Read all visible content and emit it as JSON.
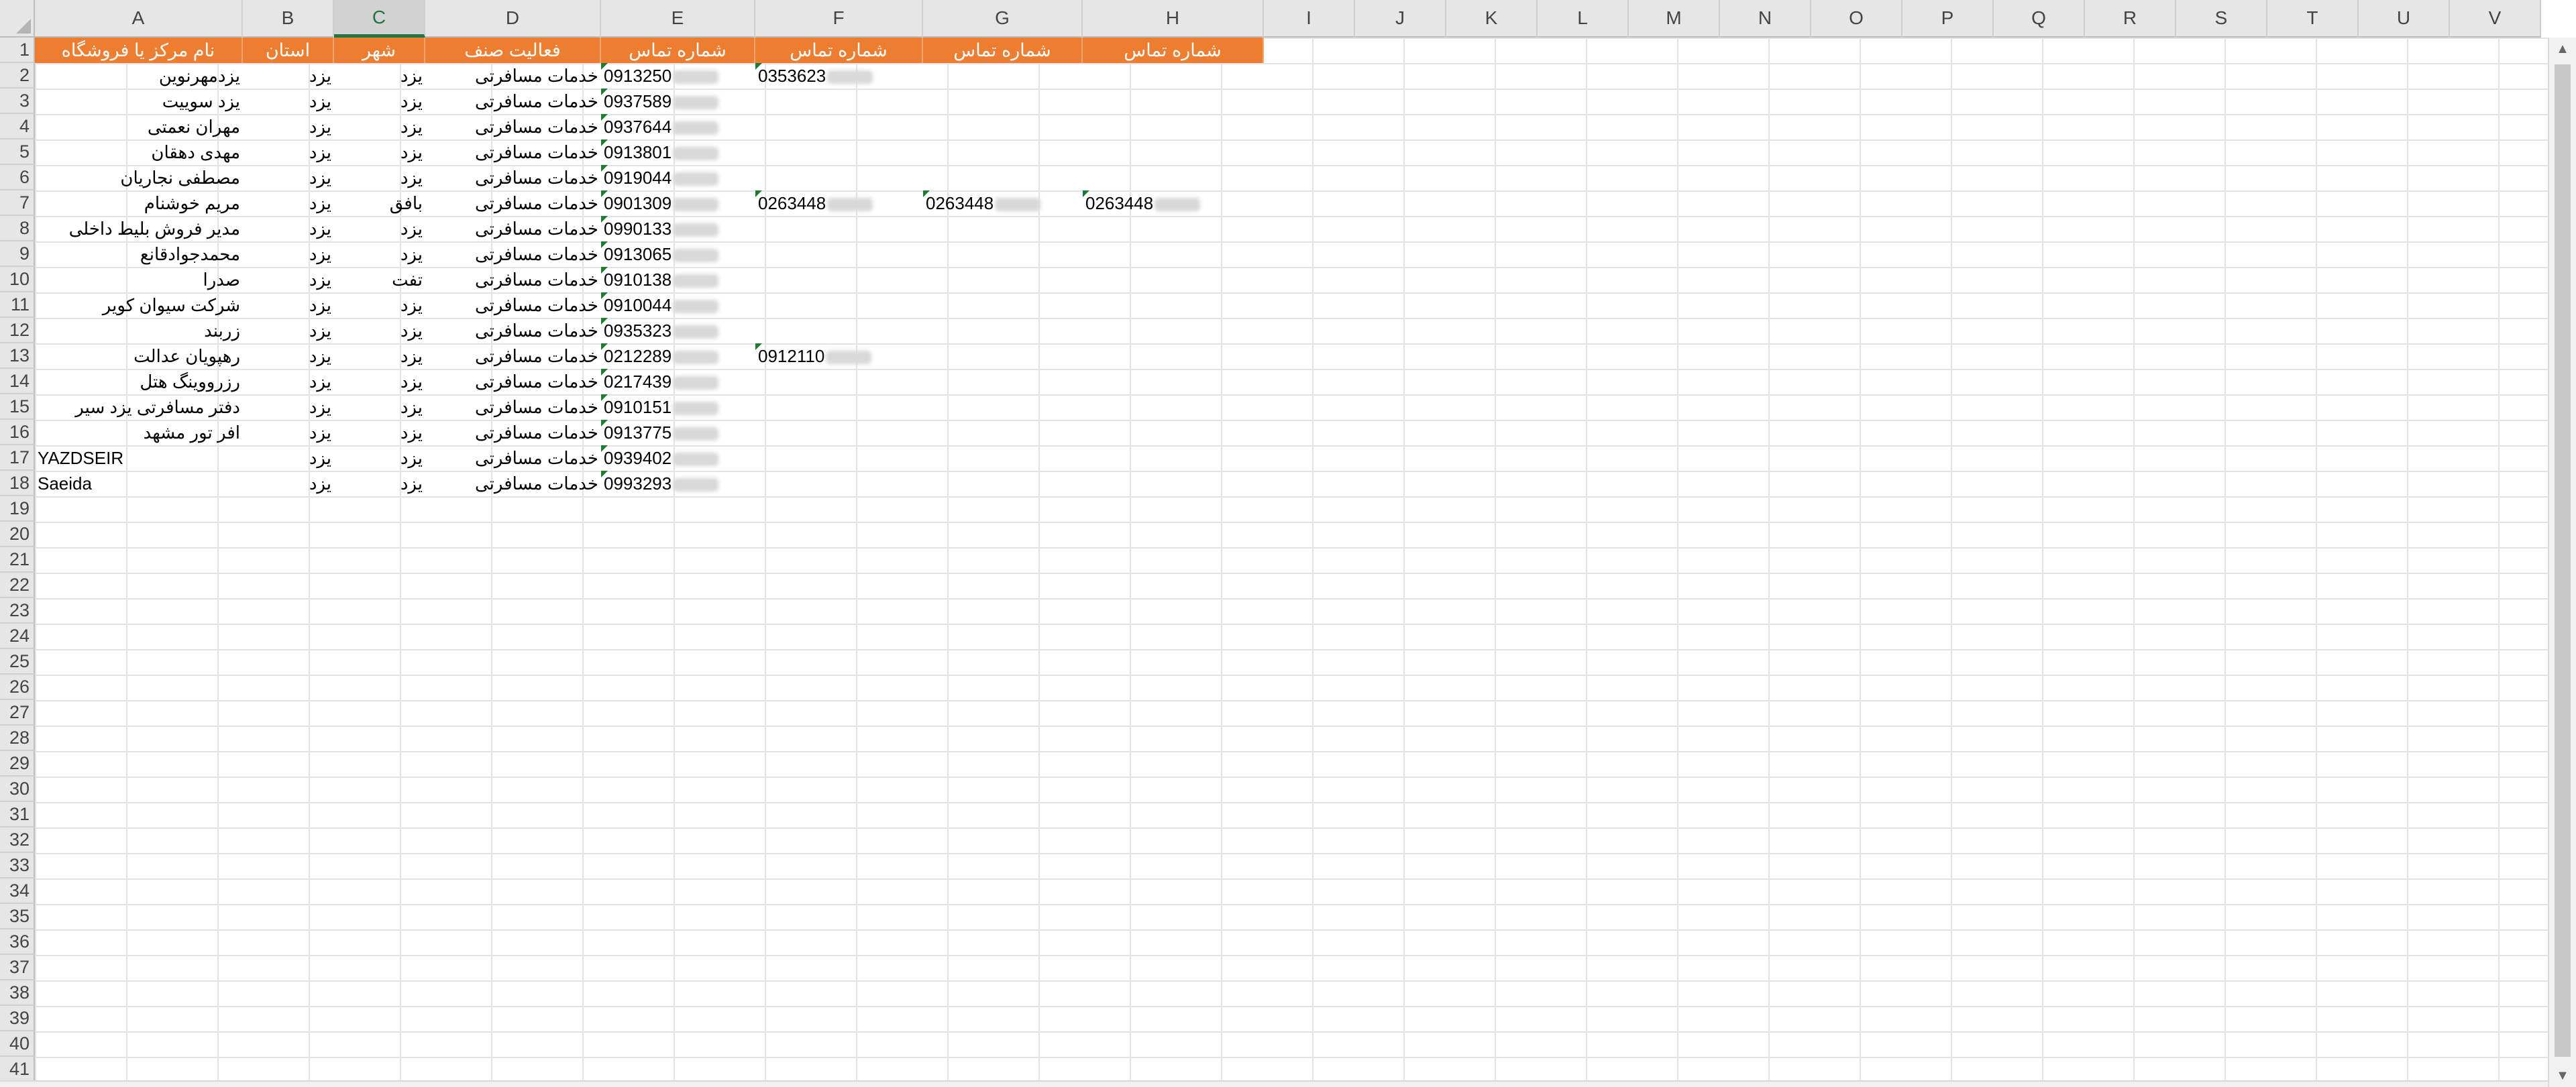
{
  "columns": [
    "A",
    "B",
    "C",
    "D",
    "E",
    "F",
    "G",
    "H",
    "I",
    "J",
    "K",
    "L",
    "M",
    "N",
    "O",
    "P",
    "Q",
    "R",
    "S",
    "T",
    "U",
    "V"
  ],
  "selected_column": "C",
  "rows": [
    "1",
    "2",
    "3",
    "4",
    "5",
    "6",
    "7",
    "8",
    "9",
    "10",
    "11",
    "12",
    "13",
    "14",
    "15",
    "16",
    "17",
    "18",
    "19",
    "20",
    "21",
    "22",
    "23",
    "24",
    "25",
    "26",
    "27",
    "28",
    "29",
    "30",
    "31",
    "32",
    "33",
    "34",
    "35",
    "36",
    "37",
    "38",
    "39",
    "40",
    "41"
  ],
  "header_row": {
    "store_name": "نام مرکز یا فروشگاه",
    "province": "استان",
    "city": "شهر",
    "activity": "فعالیت صنف",
    "phone1": "شماره تماس",
    "phone2": "شماره تماس",
    "phone3": "شماره تماس",
    "phone4": "شماره تماس"
  },
  "data_rows": [
    {
      "name": "یزدمهرنوین",
      "province": "یزد",
      "city": "یزد",
      "activity": "خدمات مسافرتی",
      "phone1": "0913250",
      "phone2": "0353623",
      "phone3": "",
      "phone4": ""
    },
    {
      "name": "یزد سوییت",
      "province": "یزد",
      "city": "یزد",
      "activity": "خدمات مسافرتی",
      "phone1": "0937589",
      "phone2": "",
      "phone3": "",
      "phone4": ""
    },
    {
      "name": "مهران نعمتی",
      "province": "یزد",
      "city": "یزد",
      "activity": "خدمات مسافرتی",
      "phone1": "0937644",
      "phone2": "",
      "phone3": "",
      "phone4": ""
    },
    {
      "name": "مهدی دهقان",
      "province": "یزد",
      "city": "یزد",
      "activity": "خدمات مسافرتی",
      "phone1": "0913801",
      "phone2": "",
      "phone3": "",
      "phone4": ""
    },
    {
      "name": "مصطفی نجاریان",
      "province": "یزد",
      "city": "یزد",
      "activity": "خدمات مسافرتی",
      "phone1": "0919044",
      "phone2": "",
      "phone3": "",
      "phone4": ""
    },
    {
      "name": "مریم خوشنام",
      "province": "یزد",
      "city": "بافق",
      "activity": "خدمات مسافرتی",
      "phone1": "0901309",
      "phone2": "0263448",
      "phone3": "0263448",
      "phone4": "0263448"
    },
    {
      "name": "مدیر فروش بلیط داخلی",
      "province": "یزد",
      "city": "یزد",
      "activity": "خدمات مسافرتی",
      "phone1": "0990133",
      "phone2": "",
      "phone3": "",
      "phone4": ""
    },
    {
      "name": "محمدجوادقانع",
      "province": "یزد",
      "city": "یزد",
      "activity": "خدمات مسافرتی",
      "phone1": "0913065",
      "phone2": "",
      "phone3": "",
      "phone4": ""
    },
    {
      "name": "صدرا",
      "province": "یزد",
      "city": "تفت",
      "activity": "خدمات مسافرتی",
      "phone1": "0910138",
      "phone2": "",
      "phone3": "",
      "phone4": ""
    },
    {
      "name": "شرکت سیوان کویر",
      "province": "یزد",
      "city": "یزد",
      "activity": "خدمات مسافرتی",
      "phone1": "0910044",
      "phone2": "",
      "phone3": "",
      "phone4": ""
    },
    {
      "name": "زربند",
      "province": "یزد",
      "city": "یزد",
      "activity": "خدمات مسافرتی",
      "phone1": "0935323",
      "phone2": "",
      "phone3": "",
      "phone4": ""
    },
    {
      "name": "رهپویان عدالت",
      "province": "یزد",
      "city": "یزد",
      "activity": "خدمات مسافرتی",
      "phone1": "0212289",
      "phone2": "0912110",
      "phone3": "",
      "phone4": ""
    },
    {
      "name": "رزرووینگ هتل",
      "province": "یزد",
      "city": "یزد",
      "activity": "خدمات مسافرتی",
      "phone1": "0217439",
      "phone2": "",
      "phone3": "",
      "phone4": ""
    },
    {
      "name": "دفتر مسافرتی یزد سیر",
      "province": "یزد",
      "city": "یزد",
      "activity": "خدمات مسافرتی",
      "phone1": "0910151",
      "phone2": "",
      "phone3": "",
      "phone4": ""
    },
    {
      "name": "افر تور مشهد",
      "province": "یزد",
      "city": "یزد",
      "activity": "خدمات مسافرتی",
      "phone1": "0913775",
      "phone2": "",
      "phone3": "",
      "phone4": ""
    },
    {
      "name": "YAZDSEIR",
      "province": "یزد",
      "city": "یزد",
      "activity": "خدمات مسافرتی",
      "phone1": "0939402",
      "phone2": "",
      "phone3": "",
      "phone4": ""
    },
    {
      "name": "Saeida",
      "province": "یزد",
      "city": "یزد",
      "activity": "خدمات مسافرتی",
      "phone1": "0993293",
      "phone2": "",
      "phone3": "",
      "phone4": ""
    }
  ],
  "scroll": {
    "up_arrow": "▲",
    "down_arrow": "▼"
  }
}
